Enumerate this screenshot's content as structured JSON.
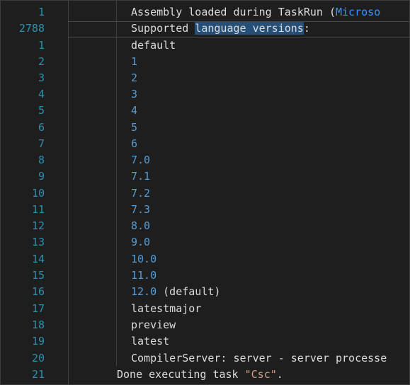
{
  "colors": {
    "background": "#1e1e1e",
    "line_number": "#2b91af",
    "text": "#dcdcdc",
    "number": "#569cd6",
    "string": "#d69d85",
    "link": "#3794ff",
    "selection": "#264f78"
  },
  "lines": [
    {
      "ln": "1",
      "pre": "Assembly loaded during TaskRun (",
      "link": "Microso"
    },
    {
      "ln": "2788",
      "pre": "Supported ",
      "sel": "language versions",
      "post": ":"
    },
    {
      "ln": "1",
      "text": "default"
    },
    {
      "ln": "2",
      "num": "1"
    },
    {
      "ln": "3",
      "num": "2"
    },
    {
      "ln": "4",
      "num": "3"
    },
    {
      "ln": "5",
      "num": "4"
    },
    {
      "ln": "6",
      "num": "5"
    },
    {
      "ln": "7",
      "num": "6"
    },
    {
      "ln": "8",
      "num": "7.0"
    },
    {
      "ln": "9",
      "num": "7.1"
    },
    {
      "ln": "10",
      "num": "7.2"
    },
    {
      "ln": "11",
      "num": "7.3"
    },
    {
      "ln": "12",
      "num": "8.0"
    },
    {
      "ln": "13",
      "num": "9.0"
    },
    {
      "ln": "14",
      "num": "10.0"
    },
    {
      "ln": "15",
      "num": "11.0"
    },
    {
      "ln": "16",
      "num": "12.0",
      "post": " (default)"
    },
    {
      "ln": "17",
      "text": "latestmajor"
    },
    {
      "ln": "18",
      "text": "preview"
    },
    {
      "ln": "19",
      "text": "latest"
    },
    {
      "ln": "20",
      "text": "CompilerServer: server - server processe"
    },
    {
      "ln": "21",
      "pre": "Done executing task ",
      "str": "\"Csc\"",
      "post": "."
    }
  ]
}
